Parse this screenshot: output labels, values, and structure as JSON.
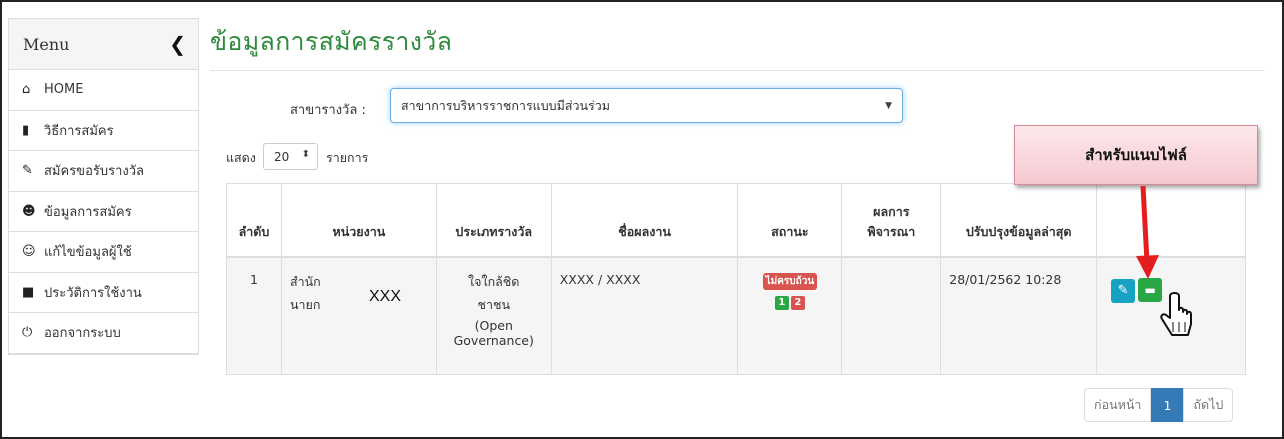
{
  "sidebar": {
    "title": "Menu",
    "items": [
      {
        "label": "HOME",
        "icon": "home-icon"
      },
      {
        "label": "วิธีการสมัคร",
        "icon": "file-icon"
      },
      {
        "label": "สมัครขอรับรางวัล",
        "icon": "pencil-icon"
      },
      {
        "label": "ข้อมูลการสมัคร",
        "icon": "users-icon"
      },
      {
        "label": "แก้ไขข้อมูลผู้ใช้",
        "icon": "user-icon"
      },
      {
        "label": "ประวัติการใช้งาน",
        "icon": "save-icon"
      },
      {
        "label": "ออกจากระบบ",
        "icon": "power-icon"
      }
    ]
  },
  "main": {
    "title": "ข้อมูลการสมัครรางวัล",
    "category_label": "สาขารางวัล :",
    "category_value": "สาขาการบริหารราชการแบบมีส่วนร่วม",
    "show_label": "แสดง",
    "page_size": "20",
    "items_label": "รายการ"
  },
  "callout": {
    "text": "สำหรับแนบไฟล์"
  },
  "table": {
    "headers": [
      "ลำดับ",
      "หน่วยงาน",
      "ประเภทรางวัล",
      "ชื่อผลงาน",
      "สถานะ",
      "ผลการ พิจารณา",
      "ปรับปรุงข้อมูลล่าสุด"
    ],
    "rows": [
      {
        "index": "1",
        "dept_line1": "สำนัก",
        "dept_line2": "นายก",
        "dept_mask": "XXX",
        "type_line1": "ใจใกล้ชิด",
        "type_line2": "ชาชน",
        "type_line3": "(Open",
        "type_line4": "Governance)",
        "work": "XXXX / XXXX",
        "status_badge": "ไม่ครบถ้วน",
        "status_n1": "1",
        "status_n2": "2",
        "result": "",
        "updated": "28/01/2562 10:28"
      }
    ]
  },
  "pagination": {
    "prev": "ก่อนหน้า",
    "current": "1",
    "next": "ถัดไป"
  },
  "colors": {
    "title_green": "#2f8b3c",
    "edit_button": "#17a2c4",
    "file_button": "#2aa745",
    "status_red": "#d9534f",
    "pager_active": "#337ab7",
    "arrow_red": "#e41e1e"
  }
}
